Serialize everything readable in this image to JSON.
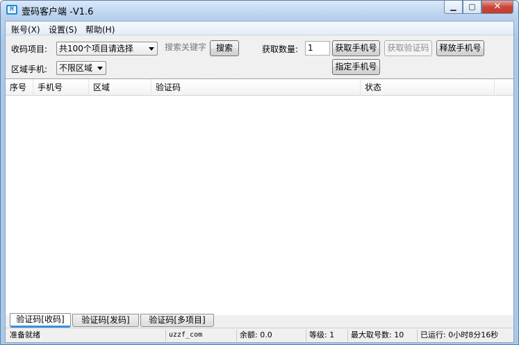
{
  "window": {
    "title": "壹码客户端 -V1.6",
    "icon": "app-icon",
    "controls": {
      "minimize": "▁",
      "maximize": "▢",
      "close": "✕"
    }
  },
  "menu": [
    "账号(X)",
    "设置(S)",
    "帮助(H)"
  ],
  "toolbar": {
    "project_label": "收码项目:",
    "project_select": "共100个项目请选择",
    "search_placeholder": "搜索关键字",
    "search_button": "搜索",
    "count_label": "获取数量:",
    "count_value": "1",
    "get_phone_button": "获取手机号",
    "get_code_button": "获取验证码",
    "release_phone_button": "释放手机号",
    "assign_phone_button": "指定手机号",
    "region_label": "区域手机:",
    "region_select": "不限区域"
  },
  "table": {
    "columns": [
      "序号",
      "手机号",
      "区域",
      "验证码",
      "状态"
    ],
    "rows": []
  },
  "tabs": [
    "验证码[收码]",
    "验证码[发码]",
    "验证码[多项目]"
  ],
  "status": {
    "ready": "准备就绪",
    "site": "uzzf_com",
    "balance": "余额: 0.0",
    "level": "等级: 1",
    "max_numbers": "最大取号数: 10",
    "runtime": "已运行: 0小时8分16秒"
  }
}
